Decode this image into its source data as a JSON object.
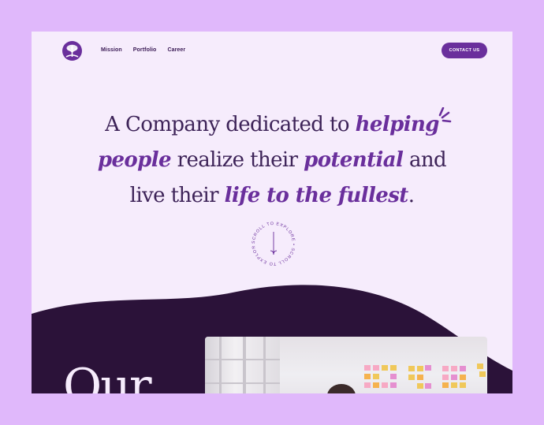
{
  "nav": {
    "items": [
      "Mission",
      "Portfolio",
      "Career"
    ],
    "contact_label": "CONTACT US"
  },
  "hero": {
    "l1_a": "A Company dedicated to ",
    "l1_b": "helping",
    "l2_a": "people",
    "l2_b": " realize their ",
    "l2_c": "potential",
    "l2_d": " and",
    "l3_a": "live their ",
    "l3_b": "life to the fullest",
    "l3_c": "."
  },
  "scroll_badge": {
    "text": "SCROLL TO EXPLORE • SCROLL TO EXPLORE •"
  },
  "section": {
    "heading": "Our"
  },
  "colors": {
    "accent": "#6a2f9c",
    "dark": "#2b1239",
    "background": "#f6ecfc",
    "outer": "#e0b8fb"
  },
  "icons": [
    "logo-tree-icon",
    "sparkle-icon",
    "down-arrow-icon"
  ]
}
